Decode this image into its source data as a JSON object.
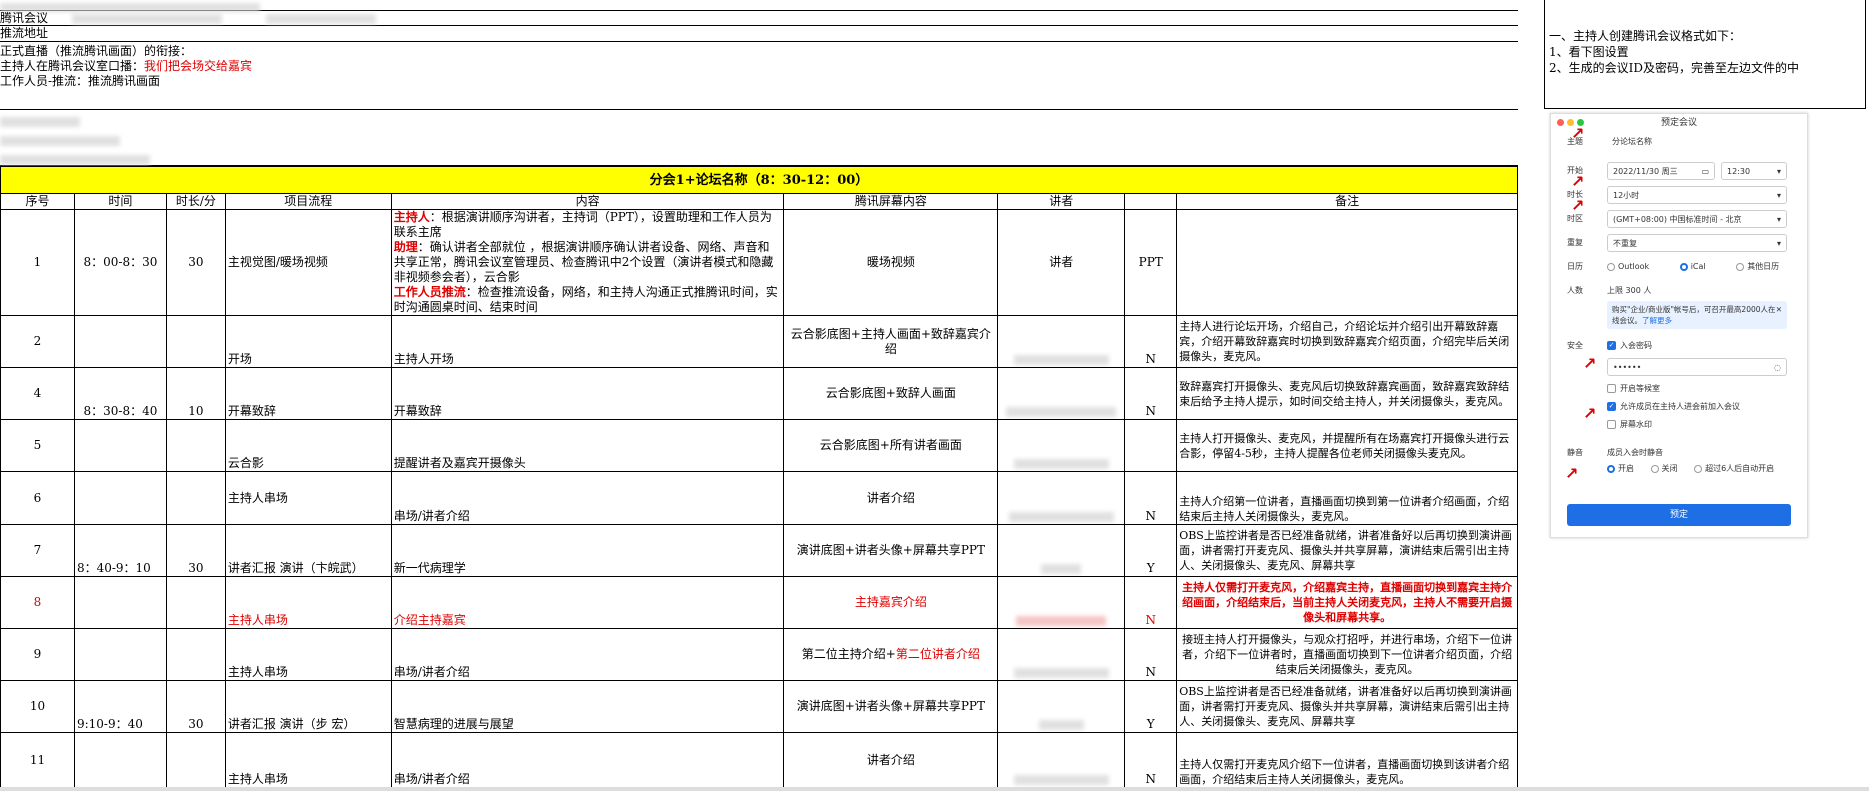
{
  "header": {
    "row1_label": "腾讯会议",
    "row2_label": "推流地址",
    "handoff_title": "正式直播（推流腾讯画面）的衔接：",
    "handoff_line1_prefix": "主持人在腾讯会议室口播：",
    "handoff_line1_red": "我们把会场交给嘉宾",
    "handoff_line2": "工作人员-推流：推流腾讯画面"
  },
  "section_title": "分会1+论坛名称（8：30-12：00）",
  "columns": [
    "序号",
    "时间",
    "时长/分",
    "项目流程",
    "内容",
    "腾讯屏幕内容",
    "讲者",
    "",
    "备注"
  ],
  "rows": [
    {
      "no": "1",
      "time": "8：00-8：30",
      "dur": "30",
      "flow": "主视觉图/暖场视频",
      "content_host_label": "主持人",
      "content_host": "：根据演讲顺序沟讲者，主持词（PPT），设置助理和工作人员为联系主席",
      "content_assist_label": "助理",
      "content_assist": "：确认讲者全部就位 ，根据演讲顺序确认讲者设备、网络、声音和共享正常，腾讯会议室管理员、检查腾讯中2个设置（演讲者模式和隐藏非视频参会者），云合影",
      "content_staff_label": "工作人员推流",
      "content_staff": "：检查推流设备，网络，和主持人沟通正式推腾讯时间，实时沟通圆桌时间、结束时间",
      "screen": "暖场视频",
      "speaker": "讲者",
      "ppt": "PPT",
      "note": ""
    },
    {
      "no": "2",
      "time": "",
      "dur": "",
      "flow": "开场",
      "content": "主持人开场",
      "screen": "云合影底图+主持人画面+致辞嘉宾介绍",
      "ppt": "N",
      "note": "主持人进行论坛开场，介绍自己，介绍论坛并介绍引出开幕致辞嘉宾，介绍开幕致辞嘉宾时切换到致辞嘉宾介绍页面，介绍完毕后关闭摄像头，麦克风。"
    },
    {
      "no": "4",
      "time": "8：30-8：40",
      "dur": "10",
      "flow": "开幕致辞",
      "content": "开幕致辞",
      "screen": "云合影底图+致辞人画面",
      "ppt": "N",
      "note": "致辞嘉宾打开摄像头、麦克风后切换致辞嘉宾画面，致辞嘉宾致辞结束后给予主持人提示，如时间交给主持人，并关闭摄像头，麦克风。"
    },
    {
      "no": "5",
      "time": "",
      "dur": "",
      "flow": "云合影",
      "content": "提醒讲者及嘉宾开摄像头",
      "screen": "云合影底图+所有讲者画面",
      "ppt": "",
      "note": "主持人打开摄像头、麦克风，并提醒所有在场嘉宾打开摄像头进行云合影，停留4-5秒，主持人提醒各位老师关闭摄像头麦克风。"
    },
    {
      "no": "6",
      "time": "",
      "dur": "",
      "flow": "主持人串场",
      "content": "串场/讲者介绍",
      "screen": "讲者介绍",
      "ppt": "N",
      "note": "主持人介绍第一位讲者，直播画面切换到第一位讲者介绍画面，介绍结束后主持人关闭摄像头，麦克风。"
    },
    {
      "no": "7",
      "time": "8：40-9：10",
      "dur": "30",
      "flow": "讲者汇报 演讲（卞皖武）",
      "content": "新一代病理学",
      "screen": "演讲底图+讲者头像+屏幕共享PPT",
      "ppt": "Y",
      "note": "OBS上监控讲者是否已经准备就绪，讲者准备好以后再切换到演讲画面，讲者需打开麦克风、摄像头并共享屏幕，演讲结束后需引出主持人、关闭摄像头、麦克风、屏幕共享"
    },
    {
      "no": "8",
      "time": "",
      "dur": "",
      "flow": "主持人串场",
      "content": "介绍主持嘉宾",
      "screen": "主持嘉宾介绍",
      "ppt": "N",
      "note": "主持人仅需打开麦克风，介绍嘉宾主持，直播画面切换到嘉宾主持介绍画面，介绍结束后，当前主持人关闭麦克风，主持人不需要开启摄像头和屏幕共享。",
      "red": true
    },
    {
      "no": "9",
      "time": "",
      "dur": "",
      "flow": "主持人串场",
      "content": "串场/讲者介绍",
      "screen_prefix": "第二位主持介绍+",
      "screen_red": "第二位讲者介绍",
      "ppt": "N",
      "note": "接班主持人打开摄像头，与观众打招呼，并进行串场，介绍下一位讲者，介绍下一位讲者时，直播画面切换到下一位讲者介绍页面，介绍结束后关闭摄像头，麦克风。"
    },
    {
      "no": "10",
      "time": "9:10-9：40",
      "dur": "30",
      "flow": "讲者汇报 演讲（步  宏）",
      "content": "智慧病理的进展与展望",
      "screen": "演讲底图+讲者头像+屏幕共享PPT",
      "ppt": "Y",
      "note": "OBS上监控讲者是否已经准备就绪，讲者准备好以后再切换到演讲画面，讲者需打开麦克风、摄像头并共享屏幕，演讲结束后需引出主持人、关闭摄像头、麦克风、屏幕共享"
    },
    {
      "no": "11",
      "time": "",
      "dur": "",
      "flow": "主持人串场",
      "content": "串场/讲者介绍",
      "screen": "讲者介绍",
      "ppt": "N",
      "note": "主持人仅需打开麦克风介绍下一位讲者，直播画面切换到该讲者介绍画面，介绍结束后主持人关闭摄像头，麦克风。"
    }
  ],
  "side_note": {
    "line1": "一、主持人创建腾讯会议格式如下：",
    "line2": "1、看下图设置",
    "line3": "2、生成的会议ID及密码，完善至左边文件的中"
  },
  "dialog": {
    "title": "预定会议",
    "subject_label": "主题",
    "subject_value": "分论坛名称",
    "start_label": "开始",
    "start_date": "2022/11/30 周三",
    "start_time": "12:30",
    "duration_label": "时长",
    "duration_value": "12小时",
    "tz_label": "时区",
    "tz_value": "(GMT+08:00) 中国标准时间 - 北京",
    "repeat_label": "重复",
    "repeat_value": "不重复",
    "calendar_label": "日历",
    "calendar_options": [
      "Outlook",
      "iCal",
      "其他日历"
    ],
    "people_label": "人数",
    "people_value": "上限 300 人",
    "notice_text": "购买\"企业/商业版\"帐号后，可召开最高2000人在线会议。",
    "notice_link": "了解更多",
    "security_label": "安全",
    "password_checkbox": "入会密码",
    "password_value": "••••••",
    "waiting_room": "开启等候室",
    "allow_before_host": "允许成员在主持人进会前加入会议",
    "watermark": "屏幕水印",
    "mute_label": "静音",
    "mute_title": "成员入会时静音",
    "mute_options": [
      "开启",
      "关闭",
      "超过6人后自动开启"
    ],
    "submit": "预定"
  },
  "colors": {
    "highlight": "#ffff00",
    "red": "#e00000",
    "primary": "#1e6fe6"
  }
}
